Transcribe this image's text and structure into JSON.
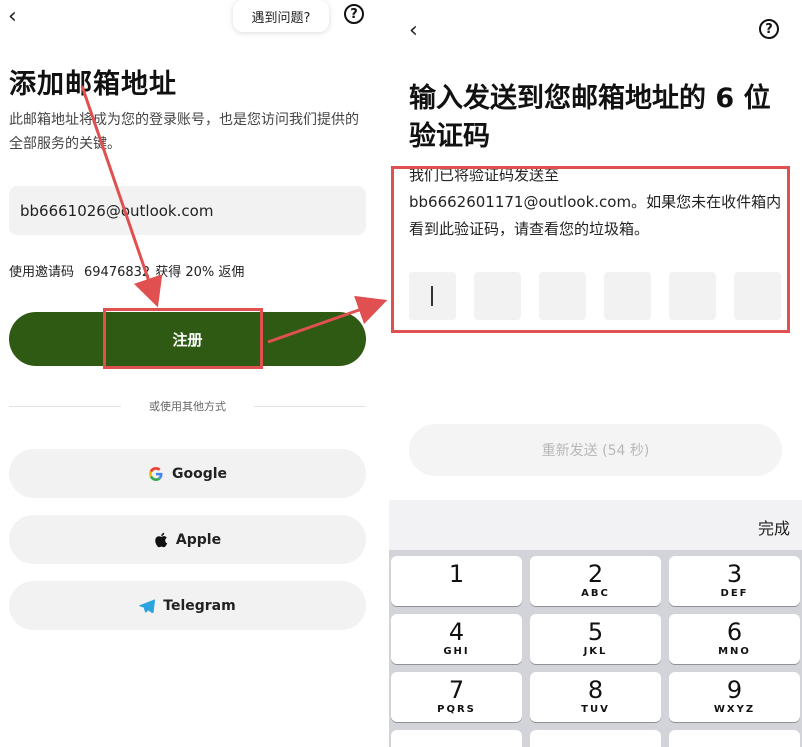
{
  "left": {
    "back_icon": "chevron-left",
    "help_bubble": "遇到问题?",
    "help_icon": "question-circle",
    "title": "添加邮箱地址",
    "description": "此邮箱地址将成为您的登录账号，也是您访问我们提供的全部服务的关键。",
    "email_value": "bb6661026@outlook.com",
    "invite_label": "使用邀请码",
    "invite_code": "69476832",
    "invite_reward": "获得 20% 返佣",
    "register_button": "注册",
    "divider_text": "或使用其他方式",
    "social": [
      {
        "label": "Google",
        "icon": "google-icon"
      },
      {
        "label": "Apple",
        "icon": "apple-icon"
      },
      {
        "label": "Telegram",
        "icon": "telegram-icon"
      }
    ],
    "accent_color": "#2e5a14"
  },
  "right": {
    "back_icon": "chevron-left",
    "help_icon": "question-circle",
    "title": "输入发送到您邮箱地址的 6 位验证码",
    "desc_line1": "我们已将验证码发送至",
    "desc_email": "bb6662601171@outlook.com",
    "desc_rest": "。如果您未在收件箱内看到此验证码，请查看您的垃圾箱。",
    "resend_button": "重新发送 (54 秒)",
    "keyboard": {
      "done": "完成",
      "keys": [
        {
          "num": "1",
          "letters": ""
        },
        {
          "num": "2",
          "letters": "ABC"
        },
        {
          "num": "3",
          "letters": "DEF"
        },
        {
          "num": "4",
          "letters": "GHI"
        },
        {
          "num": "5",
          "letters": "JKL"
        },
        {
          "num": "6",
          "letters": "MNO"
        },
        {
          "num": "7",
          "letters": "PQRS"
        },
        {
          "num": "8",
          "letters": "TUV"
        },
        {
          "num": "9",
          "letters": "WXYZ"
        }
      ]
    }
  },
  "annotation_color": "#e05050"
}
